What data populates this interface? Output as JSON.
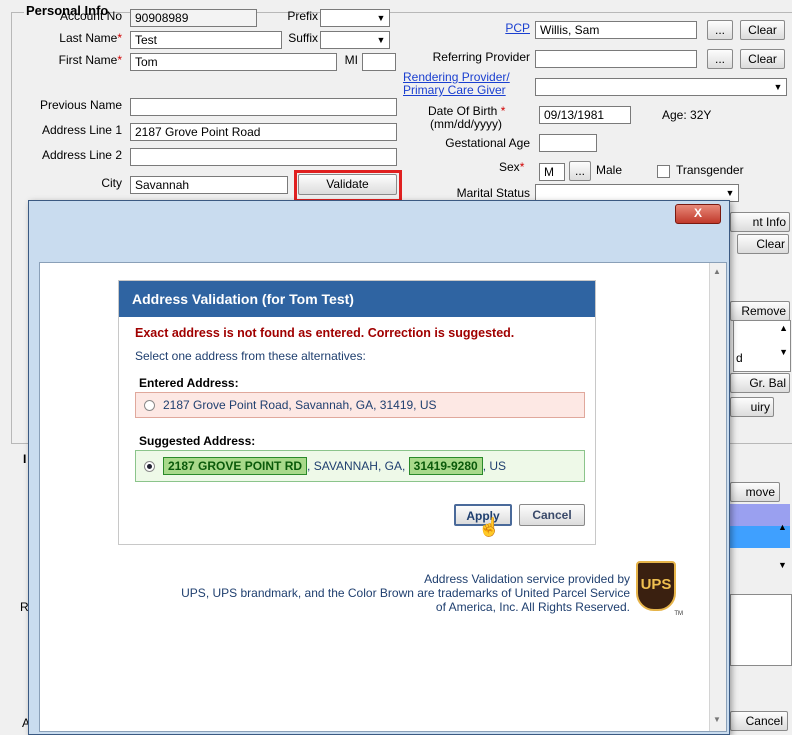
{
  "group_title": "Personal Info",
  "fields": {
    "account_no_label": "Account No",
    "account_no": "90908989",
    "prefix_label": "Prefix",
    "last_name_label": "Last Name",
    "last_name": "Test",
    "suffix_label": "Suffix",
    "first_name_label": "First Name",
    "first_name": "Tom",
    "mi_label": "MI",
    "previous_name_label": "Previous Name",
    "address1_label": "Address Line 1",
    "address1": "2187 Grove Point Road",
    "address2_label": "Address Line 2",
    "city_label": "City",
    "city": "Savannah",
    "validate_label": "Validate",
    "pcp_label": "PCP",
    "pcp": "Willis, Sam",
    "referring_label": "Referring  Provider",
    "rendering_label_1": "Rendering Provider/",
    "rendering_label_2": "Primary Care Giver",
    "dob_label": "Date Of Birth",
    "dob_hint": "(mm/dd/yyyy)",
    "dob": "09/13/1981",
    "age": "Age: 32Y",
    "gestational_label": "Gestational Age",
    "sex_label": "Sex",
    "sex": "M",
    "sex_text": "Male",
    "transgender_label": "Transgender",
    "marital_label": "Marital Status",
    "ellipsis": "...",
    "clear_label": "Clear",
    "required_mark": "*"
  },
  "background_right": {
    "ent_info": "nt Info",
    "clear": "Clear",
    "remove": "Remove",
    "d_letter": "d",
    "gr_bal": "Gr. Bal",
    "uiry": "uiry",
    "move": "move",
    "cancel": "Cancel",
    "left_I": "I",
    "left_R": "R",
    "left_A": "A"
  },
  "dialog": {
    "close": "X",
    "panel_title": "Address Validation (for Tom Test)",
    "error_message": "Exact address is not found as entered. Correction is suggested.",
    "instruction": "Select one address from these alternatives:",
    "entered_heading": "Entered Address:",
    "entered_address": "2187 Grove Point Road, Savannah, GA, 31419, US",
    "suggested_heading": "Suggested Address:",
    "suggested_street": "2187 GROVE POINT RD",
    "suggested_mid": ", SAVANNAH, GA,",
    "suggested_zip": "31419-9280",
    "suggested_tail": ", US",
    "apply": "Apply",
    "cancel": "Cancel",
    "footer_1": "Address Validation service provided by",
    "footer_2": "UPS, UPS brandmark, and the Color Brown are trademarks of United Parcel Service",
    "footer_3": "of America, Inc. All Rights Reserved.",
    "ups_logo": "UPS",
    "ups_tm": "TM"
  },
  "colors": {
    "panel_header": "#2f64a2",
    "error_text": "#a00000",
    "entered_bg": "#fde8e4",
    "suggested_bg": "#eef9e8",
    "highlight_red": "#e02020"
  }
}
